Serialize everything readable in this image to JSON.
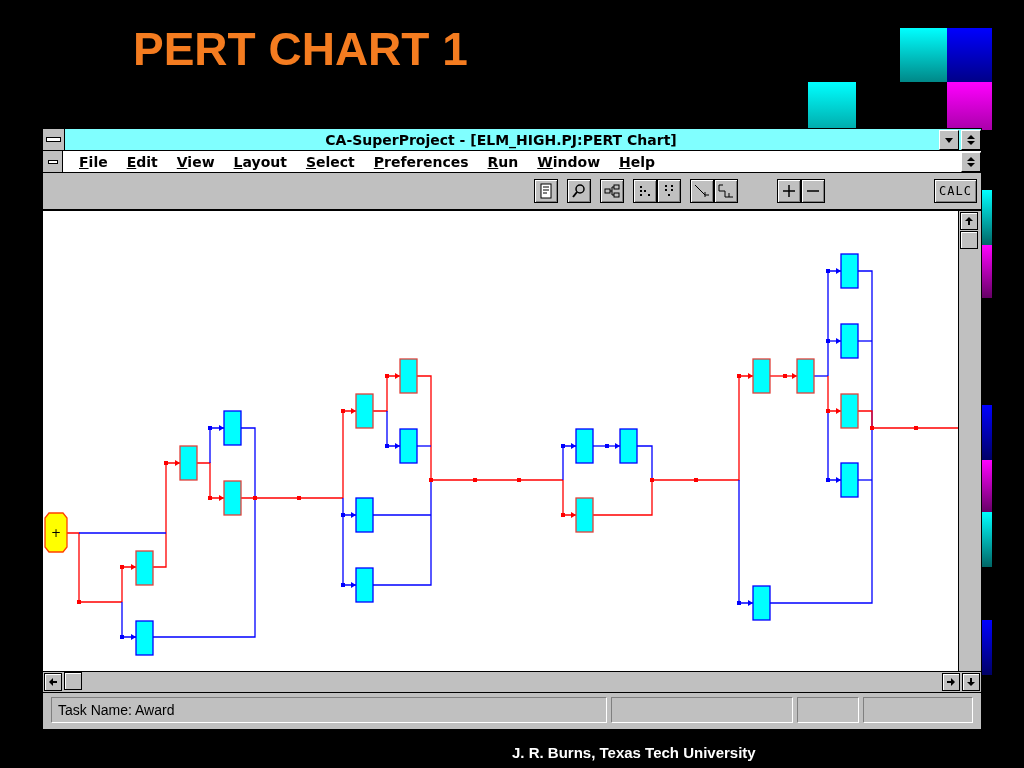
{
  "slide_title": "PERT CHART 1",
  "window": {
    "title": "CA-SuperProject - [ELM_HIGH.PJ:PERT Chart]"
  },
  "menu": [
    {
      "label": "File"
    },
    {
      "label": "Edit"
    },
    {
      "label": "View"
    },
    {
      "label": "Layout"
    },
    {
      "label": "Select"
    },
    {
      "label": "Preferences"
    },
    {
      "label": "Run"
    },
    {
      "label": "Window"
    },
    {
      "label": "Help"
    }
  ],
  "toolbar": {
    "calc_button": "CALC"
  },
  "pert_chart": {
    "start_node": {
      "label": "+"
    }
  },
  "status_bar": {
    "panels": [
      "Task Name: Award"
    ]
  },
  "footer": "J. R. Burns, Texas Tech University"
}
